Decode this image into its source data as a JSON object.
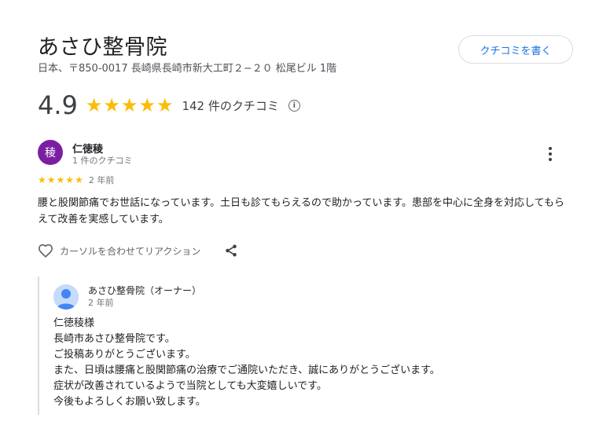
{
  "place": {
    "name": "あさひ整骨院",
    "address": "日本、〒850-0017 長崎県長崎市新大工町２−２０ 松尾ビル 1階"
  },
  "write_review_label": "クチコミを書く",
  "rating": {
    "value": "4.9",
    "stars": 5,
    "review_count": "142 件のクチコミ"
  },
  "review": {
    "avatar_letter": "稜",
    "avatar_color": "#7b1fa2",
    "author": "仁徳稜",
    "author_meta": "1 件のクチコミ",
    "stars": 5,
    "date": "2 年前",
    "text": "腰と股関節痛でお世話になっています。土日も診てもらえるので助かっています。患部を中心に全身を対応してもらえて改善を実感しています。",
    "like_label": "カーソルを合わせてリアクション"
  },
  "owner_reply": {
    "name": "あさひ整骨院（オーナー）",
    "date": "2 年前",
    "text": "仁徳稜様\n長崎市あさひ整骨院です。\nご投稿ありがとうございます。\nまた、日頃は腰痛と股関節痛の治療でご通院いただき、誠にありがとうございます。\n症状が改善されているようで当院としても大変嬉しいです。\n今後もよろしくお願い致します。"
  },
  "colors": {
    "star": "#fbbc04",
    "link": "#1a73e8"
  }
}
